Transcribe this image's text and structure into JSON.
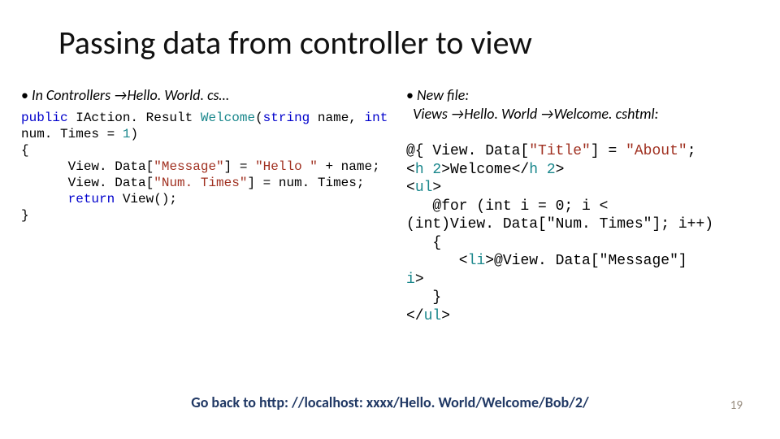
{
  "title": "Passing data from controller to view",
  "left_bullet": "In Controllers →Hello. World. cs…",
  "right_bullet_l1": "New file:",
  "right_bullet_l2": "Views →Hello. World →Welcome. cshtml:",
  "code_left": {
    "kw_public": "public",
    "ret_type": " IAction. Result ",
    "method": "Welcome",
    "paren_open": "(",
    "kw_string": "string",
    "arg_name": " name, ",
    "kw_int": "int",
    "l2a": "num. Times = ",
    "one": "1",
    "l2b": ")",
    "l3": "{",
    "l4a": "      View. Data[",
    "s1": "\"Message\"",
    "l4b": "] = ",
    "s2": "\"Hello \"",
    "l4c": " + name;",
    "l5a": "      View. Data[",
    "s3": "\"Num. Times\"",
    "l5b": "] = num. Times;",
    "l6a": "      ",
    "kw_return": "return",
    "l6b": " View();",
    "l7": "}"
  },
  "code_right": {
    "l1a": "@{ View. Data[",
    "s1": "\"Title\"",
    "l1b": "] = ",
    "s2": "\"About\"",
    "l1c": ";",
    "l2a": "<",
    "h2a": "h 2",
    "l2b": ">Welcome</",
    "h2b": "h 2",
    "l2c": ">",
    "l3a": "<",
    "ul1": "ul",
    "l3b": ">",
    "l4": "   @for (int i = 0; i <",
    "l5": "(int)View. Data[\"Num. Times\"]; i++)",
    "l6": "   {",
    "l7a": "      <",
    "li": "li",
    "l7b": ">@View. Data[\"Message\"]",
    "l8a": "i",
    "l8b": ">",
    "l9": "   }",
    "l10a": "</",
    "ul2": "ul",
    "l10b": ">"
  },
  "footer": "Go back to http: //localhost: xxxx/Hello. World/Welcome/Bob/2/",
  "page": "19"
}
